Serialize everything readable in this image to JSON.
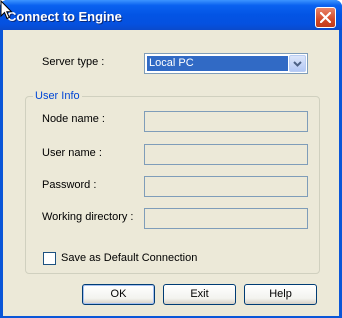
{
  "window": {
    "title": "Connect to Engine"
  },
  "server": {
    "label": "Server type :",
    "selected": "Local PC"
  },
  "user_info": {
    "group_title": "User Info",
    "node_label": "Node name :",
    "node_value": "",
    "user_label": "User name :",
    "user_value": "",
    "password_label": "Password :",
    "password_value": "",
    "dir_label": "Working directory :",
    "dir_value": ""
  },
  "default_connection": {
    "label": "Save as Default Connection",
    "checked": false
  },
  "buttons": {
    "ok": "OK",
    "exit": "Exit",
    "help": "Help"
  },
  "icons": {
    "close": "close-icon",
    "dropdown": "chevron-down-icon",
    "cursor": "mouse-pointer-icon"
  },
  "colors": {
    "titlebar": "#0354e4",
    "selection": "#316ac5",
    "group_title": "#0046d5",
    "dialog_bg": "#ece9d8"
  }
}
